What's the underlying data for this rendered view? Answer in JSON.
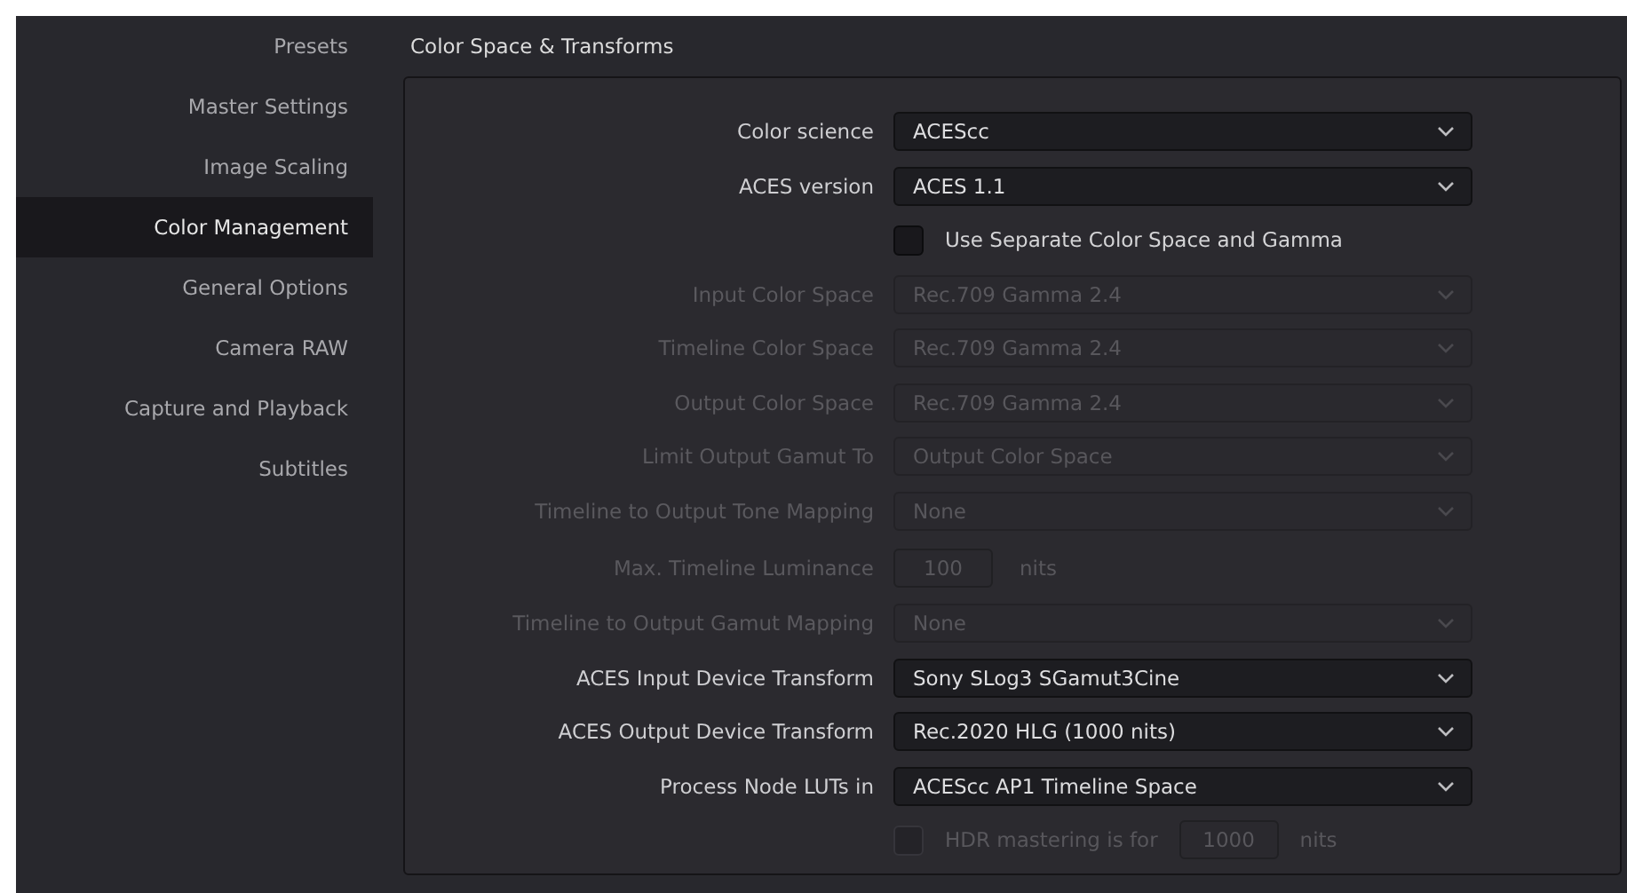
{
  "sidebar": {
    "items": [
      {
        "label": "Presets",
        "selected": false
      },
      {
        "label": "Master Settings",
        "selected": false
      },
      {
        "label": "Image Scaling",
        "selected": false
      },
      {
        "label": "Color Management",
        "selected": true
      },
      {
        "label": "General Options",
        "selected": false
      },
      {
        "label": "Camera RAW",
        "selected": false
      },
      {
        "label": "Capture and Playback",
        "selected": false
      },
      {
        "label": "Subtitles",
        "selected": false
      }
    ]
  },
  "section": {
    "title": "Color Space & Transforms",
    "rows": [
      {
        "kind": "dropdown",
        "label": "Color science",
        "value": "ACEScc",
        "disabled": false
      },
      {
        "kind": "dropdown",
        "label": "ACES version",
        "value": "ACES 1.1",
        "disabled": false
      },
      {
        "kind": "checkbox",
        "text": "Use Separate Color Space and Gamma",
        "checked": false,
        "disabled": false
      },
      {
        "kind": "dropdown",
        "label": "Input Color Space",
        "value": "Rec.709 Gamma 2.4",
        "disabled": true
      },
      {
        "kind": "dropdown",
        "label": "Timeline Color Space",
        "value": "Rec.709 Gamma 2.4",
        "disabled": true
      },
      {
        "kind": "dropdown",
        "label": "Output Color Space",
        "value": "Rec.709 Gamma 2.4",
        "disabled": true
      },
      {
        "kind": "dropdown",
        "label": "Limit Output Gamut To",
        "value": "Output Color Space",
        "disabled": true
      },
      {
        "kind": "dropdown",
        "label": "Timeline to Output Tone Mapping",
        "value": "None",
        "disabled": true
      },
      {
        "kind": "number",
        "label": "Max. Timeline Luminance",
        "value": "100",
        "unit": "nits",
        "disabled": true
      },
      {
        "kind": "dropdown",
        "label": "Timeline to Output Gamut Mapping",
        "value": "None",
        "disabled": true
      },
      {
        "kind": "dropdown",
        "label": "ACES Input Device Transform",
        "value": "Sony SLog3 SGamut3Cine",
        "disabled": false
      },
      {
        "kind": "dropdown",
        "label": "ACES Output Device Transform",
        "value": "Rec.2020 HLG (1000 nits)",
        "disabled": false
      },
      {
        "kind": "dropdown",
        "label": "Process Node LUTs in",
        "value": "ACEScc AP1 Timeline Space",
        "disabled": false
      },
      {
        "kind": "checkbox_number",
        "text": "HDR mastering is for",
        "checked": false,
        "value": "1000",
        "unit": "nits",
        "disabled": true
      }
    ]
  }
}
